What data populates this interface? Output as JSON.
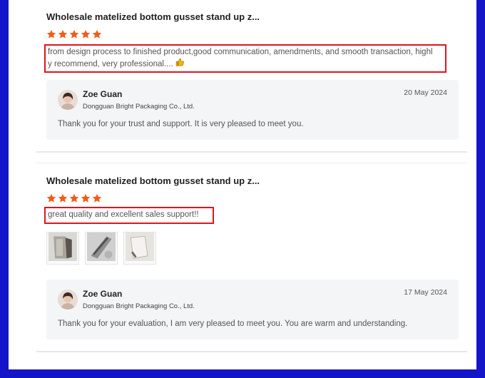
{
  "reviews": [
    {
      "title": "Wholesale matelized bottom gusset stand up z...",
      "rating": 5,
      "comment_line1": "from design process to finished product,good communication, amendments, and smooth transaction, highl",
      "comment_line2": "y recommend, very professional....",
      "comment_icon": "thumbs-up-icon",
      "reply": {
        "name": "Zoe Guan",
        "company": "Dongguan Bright Packaging Co., Ltd.",
        "date": "20 May 2024",
        "text": "Thank you for your trust and support. It is very pleased to meet you."
      }
    },
    {
      "title": "Wholesale matelized bottom gusset stand up z...",
      "rating": 5,
      "comment": "great quality and excellent sales support!!",
      "photos": [
        "bag-photo-icon",
        "bag-photo-icon",
        "bag-photo-icon"
      ],
      "reply": {
        "name": "Zoe Guan",
        "company": "Dongguan Bright Packaging Co., Ltd.",
        "date": "17 May 2024",
        "text": "Thank you for your evaluation,  I am very pleased to meet you. You are warm and understanding."
      }
    }
  ],
  "colors": {
    "star": "#f25c19",
    "highlight_border": "#e0141e",
    "frame": "#1414c8",
    "reply_bg": "#f4f5f7"
  }
}
